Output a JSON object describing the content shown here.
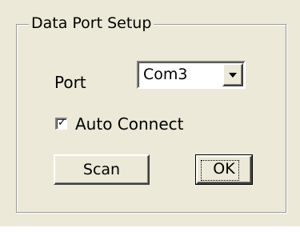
{
  "group": {
    "title": "Data Port Setup"
  },
  "port": {
    "label": "Port",
    "selected": "Com3"
  },
  "auto_connect": {
    "label": "Auto Connect",
    "checked": true,
    "check_glyph": "✓"
  },
  "buttons": {
    "scan": "Scan",
    "ok": "OK"
  }
}
